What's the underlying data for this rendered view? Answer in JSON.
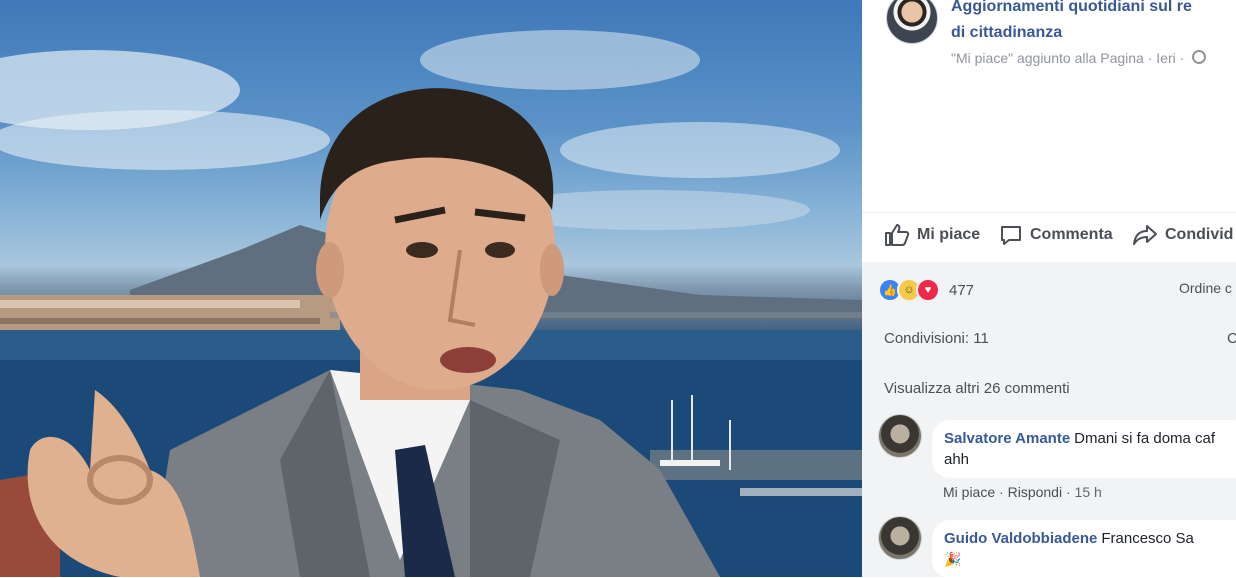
{
  "post": {
    "title_line1": "Aggiornamenti quotidiani sul re",
    "title_line2": "di cittadinanza",
    "meta_text": "\"Mi piace\" aggiunto alla Pagina · Ieri · "
  },
  "actions": {
    "like": "Mi piace",
    "comment": "Commenta",
    "share": "Condivid"
  },
  "stats": {
    "reaction_count": "477",
    "order_label": "Ordine c",
    "shares": "Condivisioni: 11",
    "shares_right": "C",
    "more_comments": "Visualizza altri 26 commenti"
  },
  "comments": [
    {
      "author": "Salvatore Amante",
      "text": "Dmani si fa doma caf ahh",
      "like": "Mi piace",
      "reply": "Rispondi",
      "time": "15 h"
    },
    {
      "author": "Guido Valdobbiadene",
      "text": "Francesco Sa"
    }
  ],
  "icons": {
    "like": "thumbs-up-icon",
    "comment": "speech-bubble-icon",
    "share": "share-arrow-icon",
    "globe": "globe-icon"
  },
  "colors": {
    "link": "#385898",
    "muted": "#90949c",
    "comments_bg": "#f2f3f5",
    "like_reaction": "#3b82f6",
    "love_reaction": "#f0284a",
    "haha_reaction": "#f7c948"
  }
}
